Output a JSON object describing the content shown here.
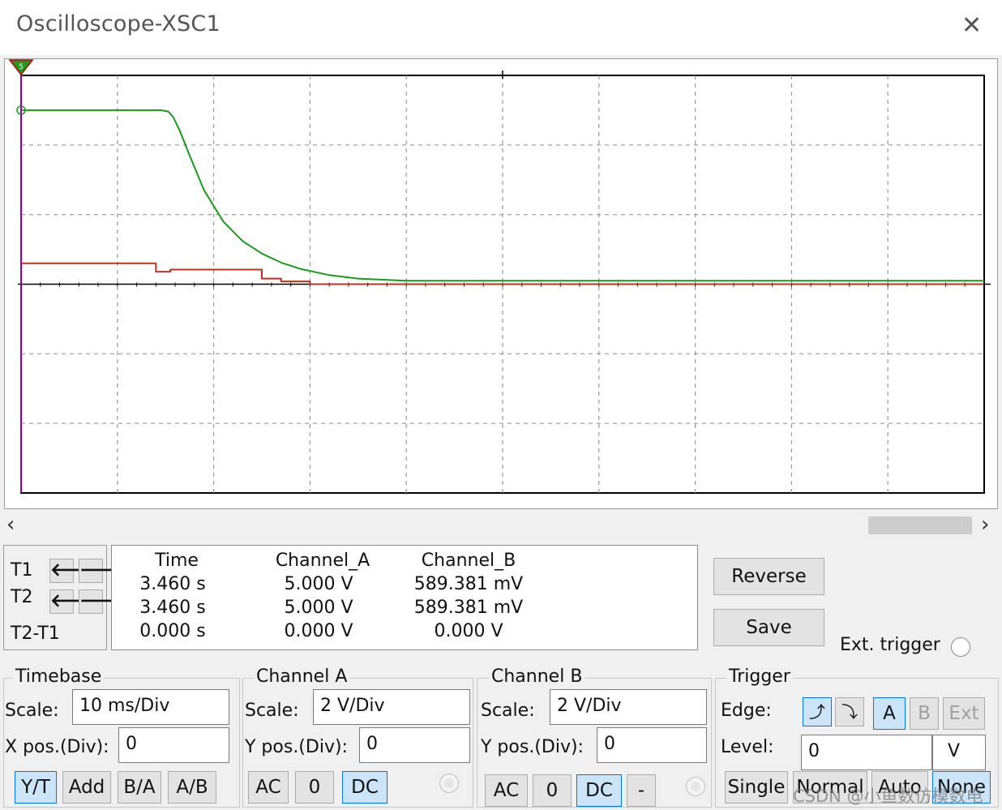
{
  "window": {
    "title": "Oscilloscope-XSC1",
    "close_icon": "close-icon"
  },
  "chart_data": {
    "type": "line",
    "grid": true,
    "x_divisions": 10,
    "y_divisions": 6,
    "xlim": [
      0,
      100
    ],
    "series": [
      {
        "color": "#1a9a1a",
        "x": [
          0,
          10,
          14.5,
          15.3,
          15.8,
          16.5,
          17.5,
          19,
          21,
          23,
          25,
          27,
          29,
          32,
          35,
          40,
          45,
          50,
          100
        ],
        "y": [
          2.5,
          2.5,
          2.5,
          2.48,
          2.4,
          2.2,
          1.85,
          1.35,
          0.9,
          0.62,
          0.44,
          0.31,
          0.22,
          0.13,
          0.08,
          0.05,
          0.05,
          0.05,
          0.05
        ]
      },
      {
        "color": "#c03020",
        "x": [
          0,
          14,
          14,
          15.5,
          15.5,
          25,
          25,
          27,
          27,
          30,
          30,
          100
        ],
        "y": [
          0.3,
          0.3,
          0.18,
          0.18,
          0.21,
          0.21,
          0.08,
          0.08,
          0.04,
          0.04,
          0.0,
          0.0
        ]
      }
    ],
    "trigger_marker_color": "#c000c0",
    "cursor_marker_label": "5"
  },
  "cursors": {
    "headers": [
      "Time",
      "Channel_A",
      "Channel_B"
    ],
    "rows": [
      {
        "label": "T1",
        "values": [
          "3.460 s",
          "5.000 V",
          "589.381 mV"
        ]
      },
      {
        "label": "T2",
        "values": [
          "3.460 s",
          "5.000 V",
          "589.381 mV"
        ]
      },
      {
        "label": "T2-T1",
        "values": [
          "0.000 s",
          "0.000 V",
          "0.000 V"
        ]
      }
    ]
  },
  "buttons": {
    "reverse": "Reverse",
    "save": "Save",
    "ext_trigger": "Ext. trigger"
  },
  "timebase": {
    "title": "Timebase",
    "scale_label": "Scale:",
    "scale": "10 ms/Div",
    "xpos_label": "X pos.(Div):",
    "xpos": "0",
    "modes": [
      "Y/T",
      "Add",
      "B/A",
      "A/B"
    ],
    "selected_mode": "Y/T"
  },
  "channel_a": {
    "title": "Channel A",
    "scale_label": "Scale:",
    "scale": "2  V/Div",
    "ypos_label": "Y pos.(Div):",
    "ypos": "0",
    "couplings": [
      "AC",
      "0",
      "DC"
    ],
    "selected": "DC"
  },
  "channel_b": {
    "title": "Channel B",
    "scale_label": "Scale:",
    "scale": "2  V/Div",
    "ypos_label": "Y pos.(Div):",
    "ypos": "0",
    "couplings": [
      "AC",
      "0",
      "DC",
      "-"
    ],
    "selected": "DC"
  },
  "trigger": {
    "title": "Trigger",
    "edge_label": "Edge:",
    "sources": [
      "A",
      "B",
      "Ext"
    ],
    "selected_source": "A",
    "level_label": "Level:",
    "level": "0",
    "level_unit": "V",
    "modes": [
      "Single",
      "Normal",
      "Auto",
      "None"
    ],
    "selected_mode": "None"
  },
  "watermark": "CSDN @小鱼数仿模数电"
}
